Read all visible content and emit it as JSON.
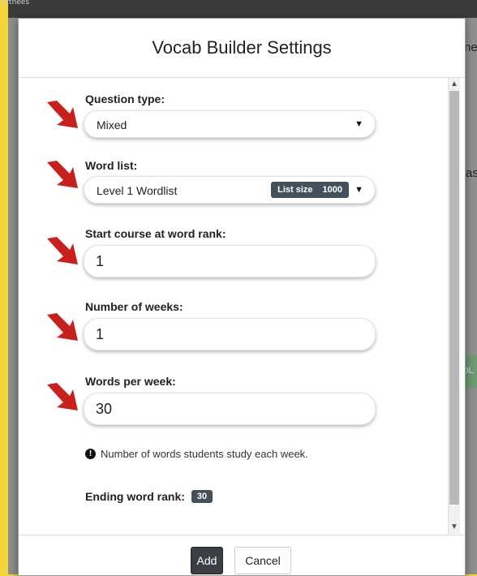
{
  "background": {
    "logo_text": "ottnees",
    "right_text_1": "ne",
    "right_text_2": "as",
    "green_label": "OL"
  },
  "modal": {
    "title": "Vocab Builder Settings",
    "question_type": {
      "label": "Question type:",
      "value": "Mixed"
    },
    "word_list": {
      "label": "Word list:",
      "value": "Level 1 Wordlist",
      "badge_label": "List size",
      "badge_value": "1000"
    },
    "start_rank": {
      "label": "Start course at word rank:",
      "value": "1"
    },
    "num_weeks": {
      "label": "Number of weeks:",
      "value": "1"
    },
    "words_per_week": {
      "label": "Words per week:",
      "value": "30",
      "help": "Number of words students study each week."
    },
    "ending_rank": {
      "label": "Ending word rank:",
      "value": "30"
    },
    "buttons": {
      "add": "Add",
      "cancel": "Cancel"
    }
  },
  "colors": {
    "page_border": "#f2d53c",
    "arrow": "#c8201c",
    "badge": "#44505c",
    "primary_button": "#3a3f45"
  }
}
